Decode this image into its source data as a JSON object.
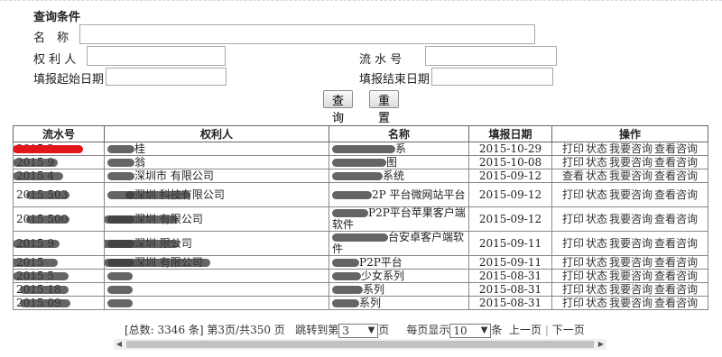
{
  "query": {
    "title": "查询条件",
    "name_label": "名　称",
    "owner_label": "权 利 人",
    "serial_label": "流 水 号",
    "start_date_label": "填报起始日期",
    "end_date_label": "填报结束日期",
    "name_value": "",
    "owner_value": "",
    "serial_value": "",
    "start_date_value": "",
    "end_date_value": "",
    "search_label": "查询",
    "reset_label": "重置"
  },
  "table": {
    "columns": [
      "流水号",
      "权利人",
      "名称",
      "填报日期",
      "操作"
    ],
    "rows": [
      {
        "serial": "2015  2",
        "owner": "桂",
        "name": "系",
        "date": "2015-10-29",
        "actions": [
          "打印",
          "状态",
          "我要咨询",
          "查看咨询"
        ]
      },
      {
        "serial": "2015  9",
        "owner": "翁",
        "name": "图",
        "date": "2015-10-08",
        "actions": [
          "打印",
          "状态",
          "我要咨询",
          "查看咨询"
        ]
      },
      {
        "serial": "2015  4",
        "owner": "深圳市 有限公司",
        "name": "系统",
        "date": "2015-09-12",
        "actions": [
          "查看",
          "状态",
          "我要咨询",
          "查看咨询"
        ]
      },
      {
        "serial": "2015  503",
        "owner": "深圳 科技有限公司",
        "name": "2P 平台微网站平台",
        "date": "2015-09-12",
        "actions": [
          "打印",
          "状态",
          "我要咨询",
          "查看咨询"
        ]
      },
      {
        "serial": "2015  500",
        "owner": "深圳 有限公司",
        "name": "P2P平台苹果客户端软件",
        "date": "2015-09-12",
        "actions": [
          "打印",
          "状态",
          "我要咨询",
          "查看咨询"
        ]
      },
      {
        "serial": "2015  9",
        "owner": "深圳 限公司",
        "name": "台安卓客户端软件",
        "date": "2015-09-11",
        "actions": [
          "打印",
          "状态",
          "我要咨询",
          "查看咨询"
        ]
      },
      {
        "serial": "2015  ",
        "owner": "深圳 有限公司",
        "name": "P2P平台",
        "date": "2015-09-11",
        "actions": [
          "打印",
          "状态",
          "我要咨询",
          "查看咨询"
        ]
      },
      {
        "serial": "2015  5",
        "owner": "",
        "name": "少女系列",
        "date": "2015-08-31",
        "actions": [
          "打印",
          "状态",
          "我要咨询",
          "查看咨询"
        ]
      },
      {
        "serial": "2015  18",
        "owner": "",
        "name": "系列",
        "date": "2015-08-31",
        "actions": [
          "打印",
          "状态",
          "我要咨询",
          "查看咨询"
        ]
      },
      {
        "serial": "2015  09",
        "owner": "",
        "name": "系列",
        "date": "2015-08-31",
        "actions": [
          "打印",
          "状态",
          "我要咨询",
          "查看咨询"
        ]
      }
    ]
  },
  "pager": {
    "total": "[总数: 3346 条]",
    "page_info": "第3页/共350 页",
    "jump_prefix": "跳转到第",
    "jump_value": "3",
    "jump_suffix": "页",
    "per_page_prefix": "每页显示",
    "per_page_value": "10",
    "per_page_suffix": "条",
    "prev": "上一页",
    "separator": "|",
    "next": "下一页"
  },
  "icons": {
    "dropdown": "chevron-down-icon",
    "scroll_left": "arrow-left-icon",
    "scroll_right": "arrow-right-icon"
  },
  "colors": {
    "redacted_highlight": "#e0161b",
    "border": "#888888"
  }
}
